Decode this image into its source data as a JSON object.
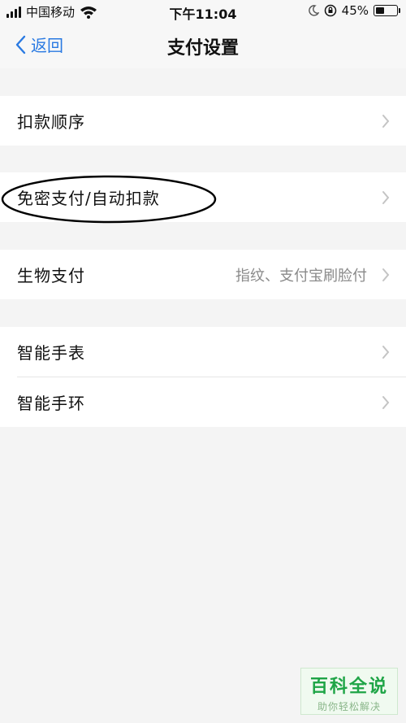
{
  "status_bar": {
    "carrier": "中国移动",
    "time": "下午11:04",
    "battery_percent": "45%",
    "battery_level": 0.45
  },
  "nav": {
    "back_label": "返回",
    "title": "支付设置"
  },
  "groups": [
    {
      "items": [
        {
          "label": "扣款顺序",
          "value": ""
        }
      ]
    },
    {
      "items": [
        {
          "label": "免密支付/自动扣款",
          "value": ""
        }
      ]
    },
    {
      "items": [
        {
          "label": "生物支付",
          "value": "指纹、支付宝刷脸付"
        }
      ]
    },
    {
      "items": [
        {
          "label": "智能手表",
          "value": ""
        },
        {
          "label": "智能手环",
          "value": ""
        }
      ]
    }
  ],
  "watermark": {
    "title": "百科全说",
    "subtitle": "助你轻松解决"
  },
  "colors": {
    "accent": "#2a7ae2",
    "background": "#f4f4f4",
    "watermark_green": "#1fa547"
  }
}
